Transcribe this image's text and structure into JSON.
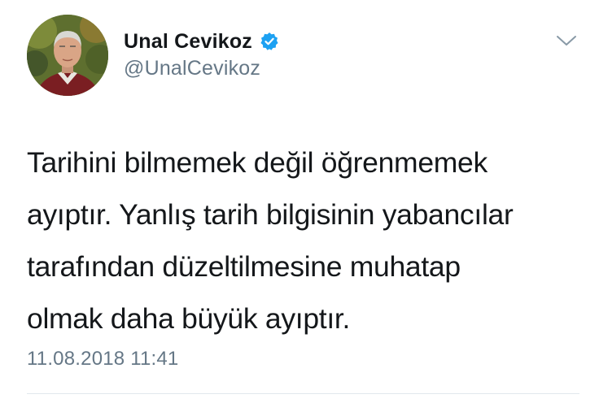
{
  "tweet": {
    "author": {
      "display_name": "Unal Cevikoz",
      "handle": "@UnalCevikoz",
      "verified": true,
      "avatar_icon": "profile-photo"
    },
    "text": "Tarihini bilmemek değil öğrenmemek\nayıptır. Yanlış tarih bilgisinin yabancılar\ntarafından düzeltilmesine muhatap\nolmak daha büyük ayıptır.",
    "timestamp": "11.08.2018 11:41",
    "menu_icon": "chevron-down-icon"
  },
  "colors": {
    "text_primary": "#14171a",
    "text_secondary": "#657786",
    "verified_blue": "#1da1f2",
    "divider": "#e1e8ed"
  }
}
